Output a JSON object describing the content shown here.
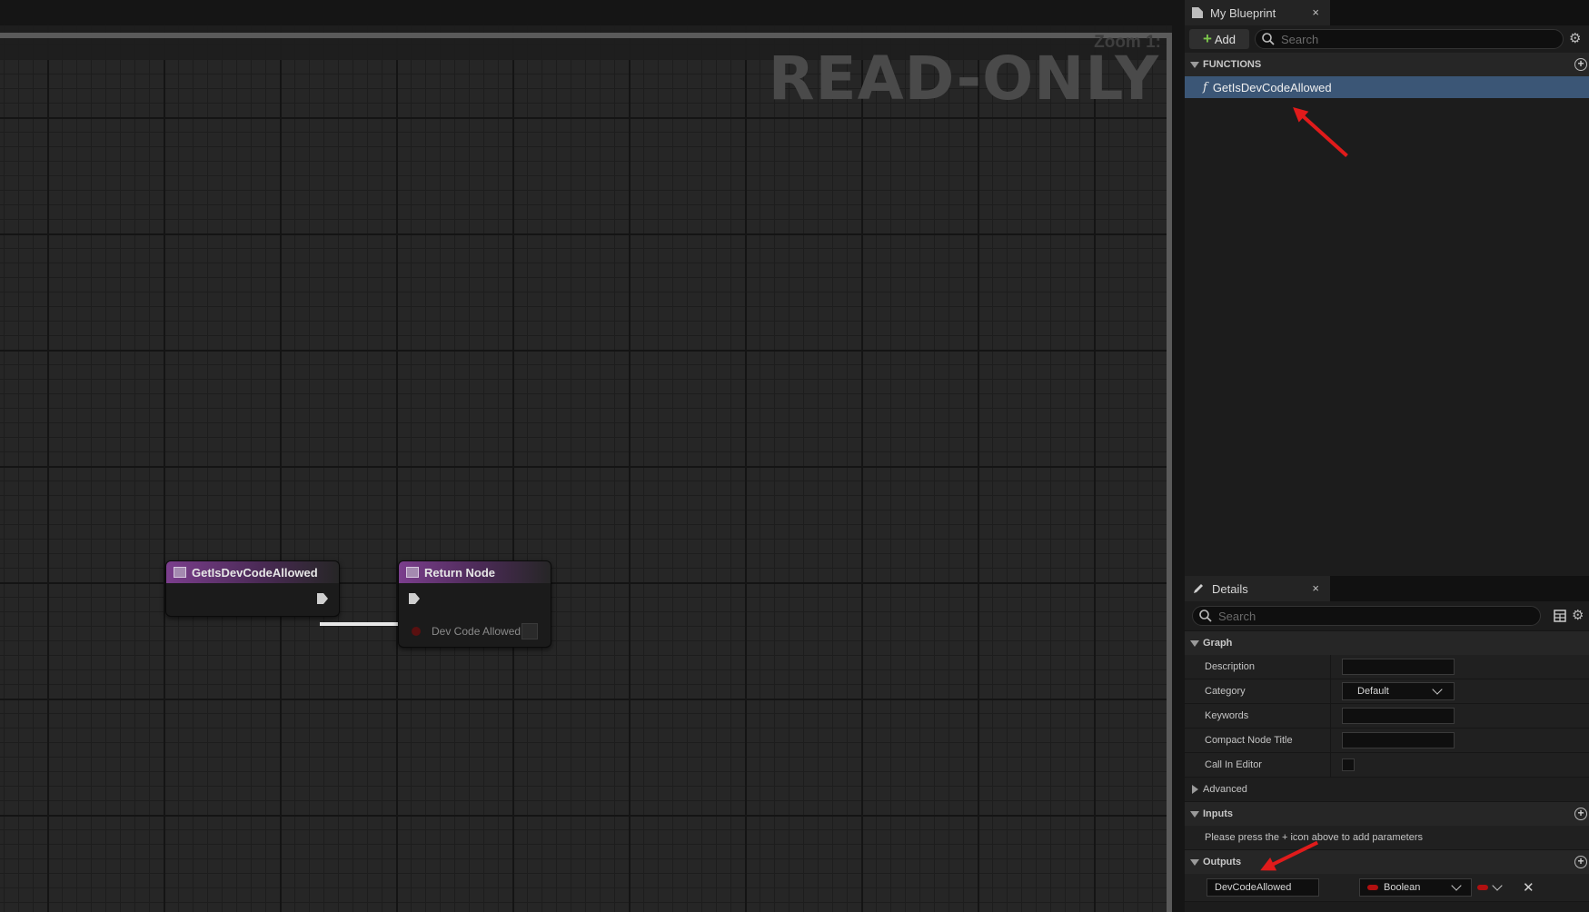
{
  "graph": {
    "zoom_label": "Zoom 1:",
    "readonly_label": "READ-ONLY",
    "entry_node": {
      "title": "GetIsDevCodeAllowed"
    },
    "return_node": {
      "title": "Return Node",
      "pin_label": "Dev Code Allowed"
    }
  },
  "my_blueprint": {
    "tab_title": "My Blueprint",
    "close": "×",
    "add_label": "Add",
    "search_placeholder": "Search",
    "functions_header": "FUNCTIONS",
    "functions": [
      {
        "name": "GetIsDevCodeAllowed",
        "icon": "f"
      }
    ]
  },
  "details": {
    "tab_title": "Details",
    "close": "×",
    "search_placeholder": "Search",
    "graph_section": "Graph",
    "description_label": "Description",
    "category_label": "Category",
    "category_value": "Default",
    "keywords_label": "Keywords",
    "compact_title_label": "Compact Node Title",
    "call_in_editor_label": "Call In Editor",
    "advanced_label": "Advanced",
    "inputs_section": "Inputs",
    "inputs_hint": "Please press the + icon above to add parameters",
    "outputs_section": "Outputs",
    "output_name": "DevCodeAllowed",
    "output_type": "Boolean",
    "remove": "✕"
  },
  "colors": {
    "selection": "#3b5676",
    "node_header": "#7b3e8d",
    "boolean_pin": "#8b0000",
    "annotation_arrow": "#e01b1b",
    "add_plus": "#7cc64b"
  }
}
